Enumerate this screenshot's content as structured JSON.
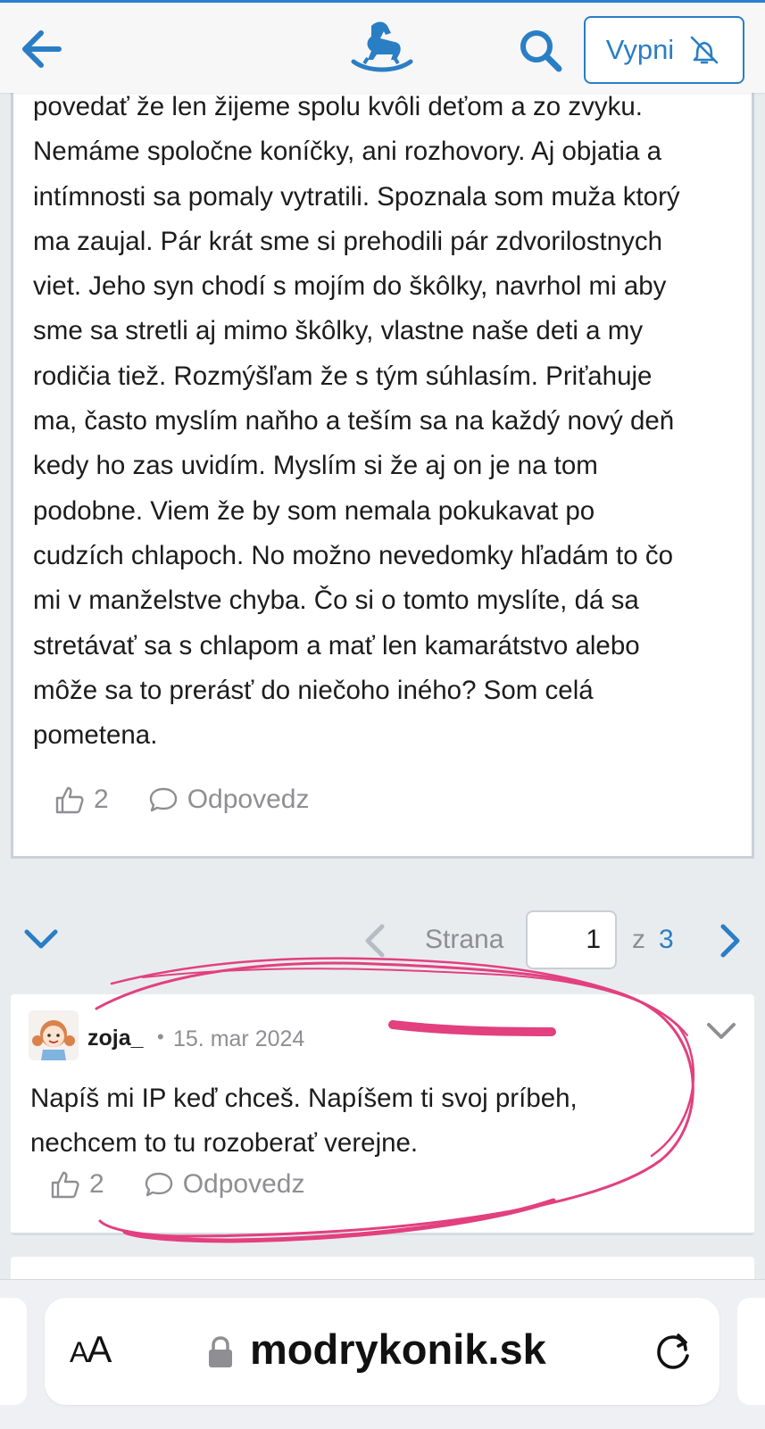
{
  "colors": {
    "accent": "#2a7ec4",
    "scribble": "#e2407f",
    "muted": "#8e8e93"
  },
  "topbar": {
    "back_icon": "arrow-left-icon",
    "logo_icon": "rocking-horse-icon",
    "search_icon": "search-icon",
    "mute_button_label": "Vypni",
    "mute_icon": "bell-slash-icon"
  },
  "post": {
    "lines": [
      "povedať že len žijeme spolu kvôli deťom a zo zvyku.",
      "Nemáme spoločne koníčky, ani rozhovory. Aj objatia a",
      "intímnosti sa pomaly vytratili. Spoznala som muža ktorý",
      "ma zaujal. Pár krát sme si prehodili pár zdvorilostnych",
      "viet. Jeho syn chodí s mojím do škôlky, navrhol mi aby",
      "sme sa stretli aj mimo škôlky, vlastne naše deti a my",
      "rodičia tiež. Rozmýšľam že s tým súhlasím. Priťahuje",
      "ma, často myslím naňho a teším sa na každý nový deň",
      "kedy ho zas uvidím. Myslím si že aj on je na tom",
      "podobne. Viem že by som nemala pokukavat po",
      "cudzích chlapoch. No možno nevedomky hľadám to čo",
      "mi v manželstve chyba. Čo si o tomto myslíte, dá sa",
      "stretávať sa s chlapom a mať len kamarátstvo alebo",
      "môže sa to prerásť do niečoho iného? Som celá",
      "pometena."
    ],
    "likes": "2",
    "reply_label": "Odpovedz"
  },
  "pager": {
    "label": "Strana",
    "current_page": "1",
    "of_label": "z",
    "total_pages": "3"
  },
  "comment": {
    "username": "zoja_",
    "separator": "•",
    "date": "15. mar 2024",
    "lines": [
      "Napíš mi IP keď chceš. Napíšem ti svoj príbeh,",
      "nechcem to tu rozoberať verejne."
    ],
    "likes": "2",
    "reply_label": "Odpovedz"
  },
  "browser": {
    "text_size_label_small": "A",
    "text_size_label_large": "A",
    "url": "modrykonik.sk",
    "lock_icon": "lock-icon",
    "reload_icon": "reload-icon"
  }
}
